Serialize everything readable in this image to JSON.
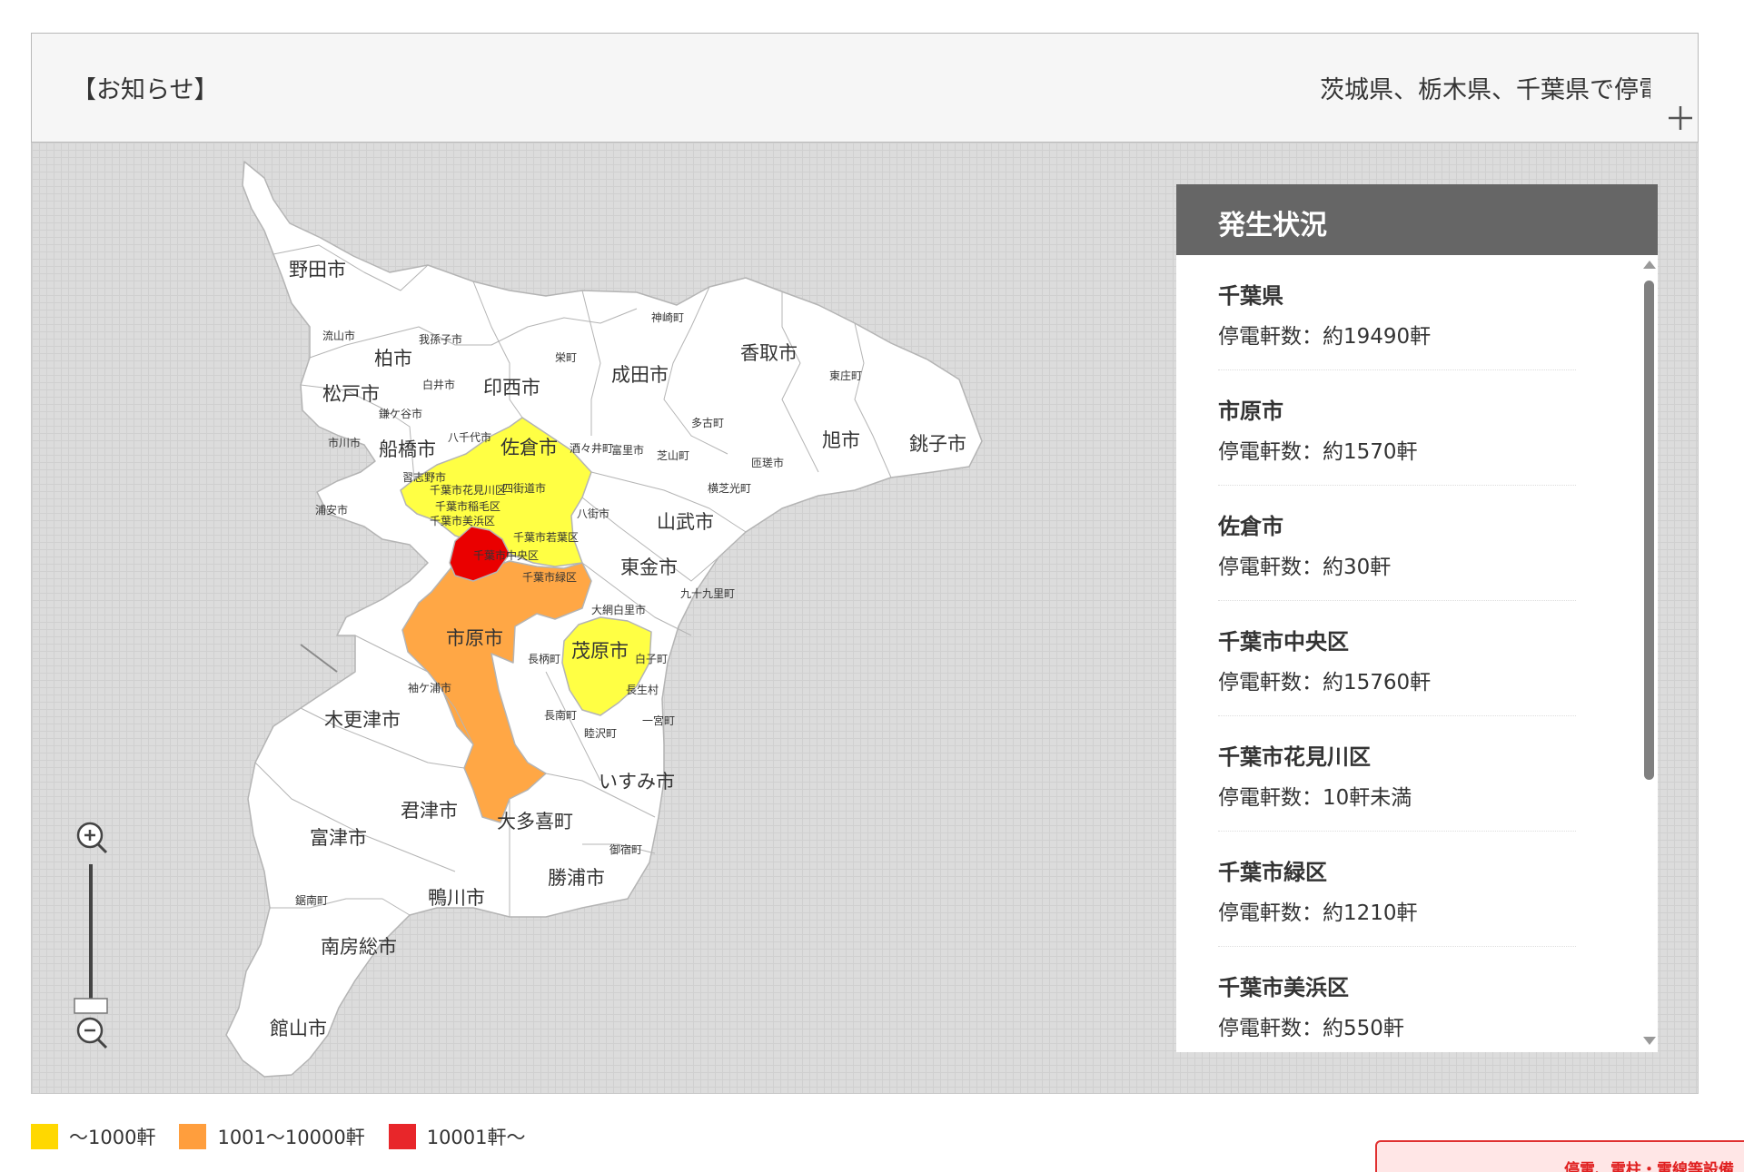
{
  "notice": {
    "label": "【お知らせ】",
    "ticker": "茨城県、栃木県、千葉県で停電"
  },
  "panel": {
    "title": "発生状況",
    "items": [
      {
        "name": "千葉県",
        "count": "停電軒数：約19490軒"
      },
      {
        "name": "市原市",
        "count": "停電軒数：約1570軒"
      },
      {
        "name": "佐倉市",
        "count": "停電軒数：約30軒"
      },
      {
        "name": "千葉市中央区",
        "count": "停電軒数：約15760軒"
      },
      {
        "name": "千葉市花見川区",
        "count": "停電軒数：10軒未満"
      },
      {
        "name": "千葉市緑区",
        "count": "停電軒数：約1210軒"
      },
      {
        "name": "千葉市美浜区",
        "count": "停電軒数：約550軒"
      }
    ]
  },
  "legend": [
    {
      "label": "～1000軒",
      "color": "#ffd800"
    },
    {
      "label": "1001～10000軒",
      "color": "#ff9e3d"
    },
    {
      "label": "10001軒～",
      "color": "#e8262a"
    }
  ],
  "map": {
    "colors": {
      "low": "#ffff44",
      "mid": "#ffa745",
      "high": "#ea0000",
      "none": "#ffffff",
      "border": "#b4b4b4"
    },
    "labels_large": [
      "野田市",
      "柏市",
      "松戸市",
      "印西市",
      "成田市",
      "香取市",
      "船橋市",
      "佐倉市",
      "旭市",
      "銚子市",
      "山武市",
      "東金市",
      "市原市",
      "茂原市",
      "木更津市",
      "いすみ市",
      "君津市",
      "大多喜町",
      "富津市",
      "勝浦市",
      "鴨川市",
      "南房総市",
      "館山市"
    ],
    "labels_small": [
      "流山市",
      "我孫子市",
      "神崎町",
      "栄町",
      "白井市",
      "東庄町",
      "鎌ケ谷市",
      "多古町",
      "八千代市",
      "市川市",
      "酒々井町",
      "富里市",
      "芝山町",
      "匝瑳市",
      "習志野市",
      "四街道市",
      "横芝光町",
      "浦安市",
      "千葉市花見川区",
      "千葉市稲毛区",
      "八街市",
      "千葉市美浜区",
      "千葉市若葉区",
      "千葉市中央区",
      "千葉市緑区",
      "九十九里町",
      "大網白里市",
      "白子町",
      "長柄町",
      "袖ケ浦市",
      "長生村",
      "長南町",
      "睦沢町",
      "一宮町",
      "御宿町",
      "鋸南町"
    ]
  },
  "banner": {
    "text": "停電、電柱・電線等設備"
  }
}
